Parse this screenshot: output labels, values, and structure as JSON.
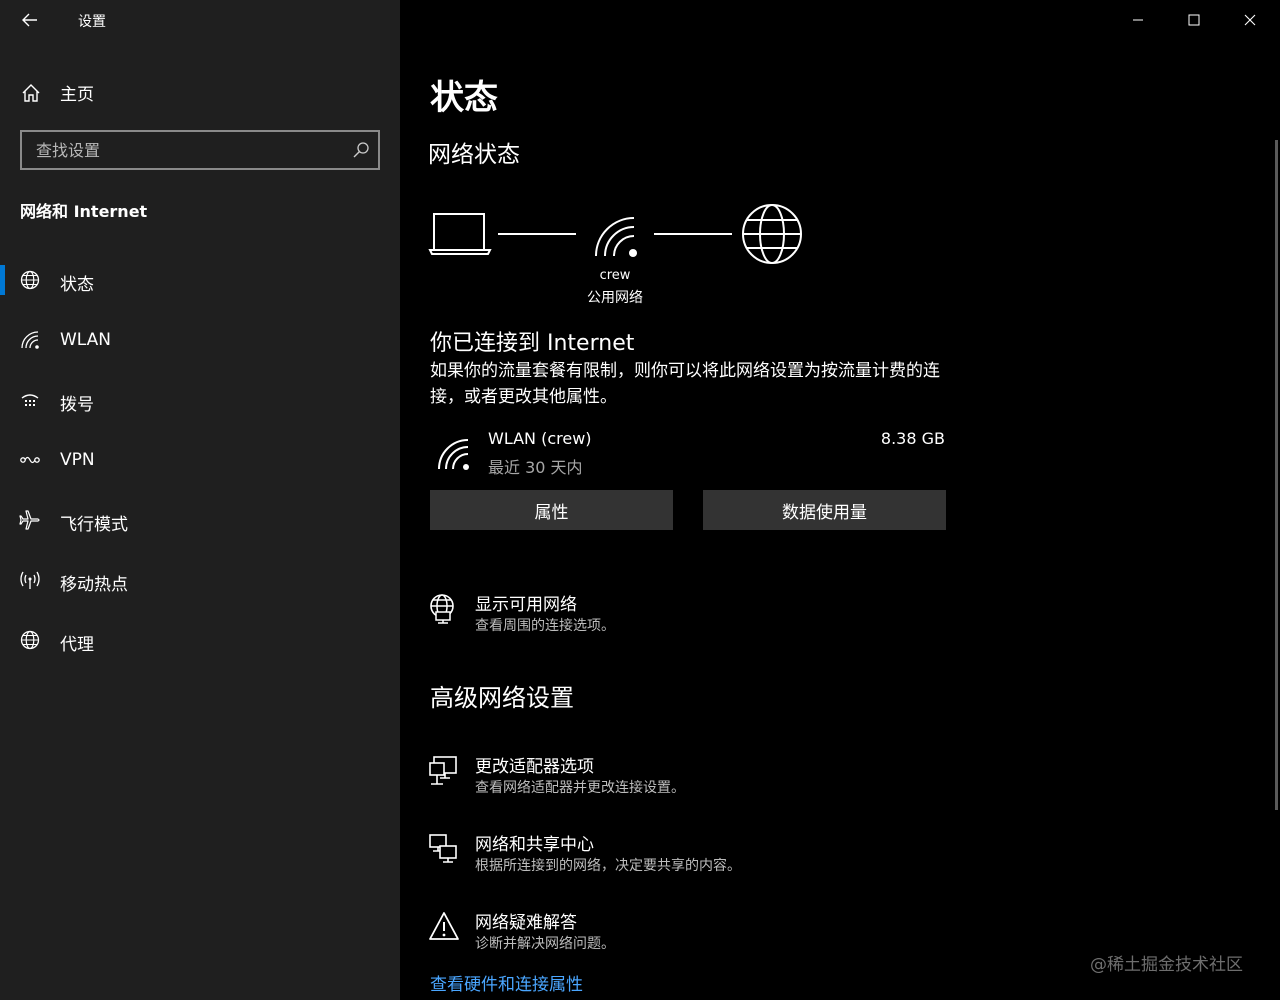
{
  "window": {
    "app_title": "设置"
  },
  "sidebar": {
    "home_label": "主页",
    "search_placeholder": "查找设置",
    "section_title": "网络和 Internet",
    "items": [
      {
        "label": "状态",
        "icon": "globe-status-icon",
        "selected": true
      },
      {
        "label": "WLAN",
        "icon": "wifi-icon",
        "selected": false
      },
      {
        "label": "拨号",
        "icon": "dialup-icon",
        "selected": false
      },
      {
        "label": "VPN",
        "icon": "vpn-icon",
        "selected": false
      },
      {
        "label": "飞行模式",
        "icon": "airplane-icon",
        "selected": false
      },
      {
        "label": "移动热点",
        "icon": "hotspot-icon",
        "selected": false
      },
      {
        "label": "代理",
        "icon": "globe-icon",
        "selected": false
      }
    ],
    "accent_color": "#0078d4"
  },
  "main": {
    "page_title": "状态",
    "network_status_title": "网络状态",
    "diagram": {
      "ssid": "crew",
      "network_type": "公用网络"
    },
    "connected_title": "你已连接到 Internet",
    "description": "如果你的流量套餐有限制，则你可以将此网络设置为按流量计费的连接，或者更改其他属性。",
    "connection": {
      "name": "WLAN (crew)",
      "period": "最近 30 天内",
      "usage": "8.38 GB"
    },
    "buttons": {
      "properties": "属性",
      "data_usage": "数据使用量"
    },
    "show_networks": {
      "title": "显示可用网络",
      "subtitle": "查看周围的连接选项。"
    },
    "advanced_title": "高级网络设置",
    "advanced_items": [
      {
        "title": "更改适配器选项",
        "subtitle": "查看网络适配器并更改连接设置。",
        "icon": "adapter-icon"
      },
      {
        "title": "网络和共享中心",
        "subtitle": "根据所连接到的网络，决定要共享的内容。",
        "icon": "sharing-center-icon"
      },
      {
        "title": "网络疑难解答",
        "subtitle": "诊断并解决网络问题。",
        "icon": "warning-icon"
      }
    ],
    "hardware_link": "查看硬件和连接属性",
    "link_color": "#4aa6ff"
  },
  "watermark": "@稀土掘金技术社区"
}
